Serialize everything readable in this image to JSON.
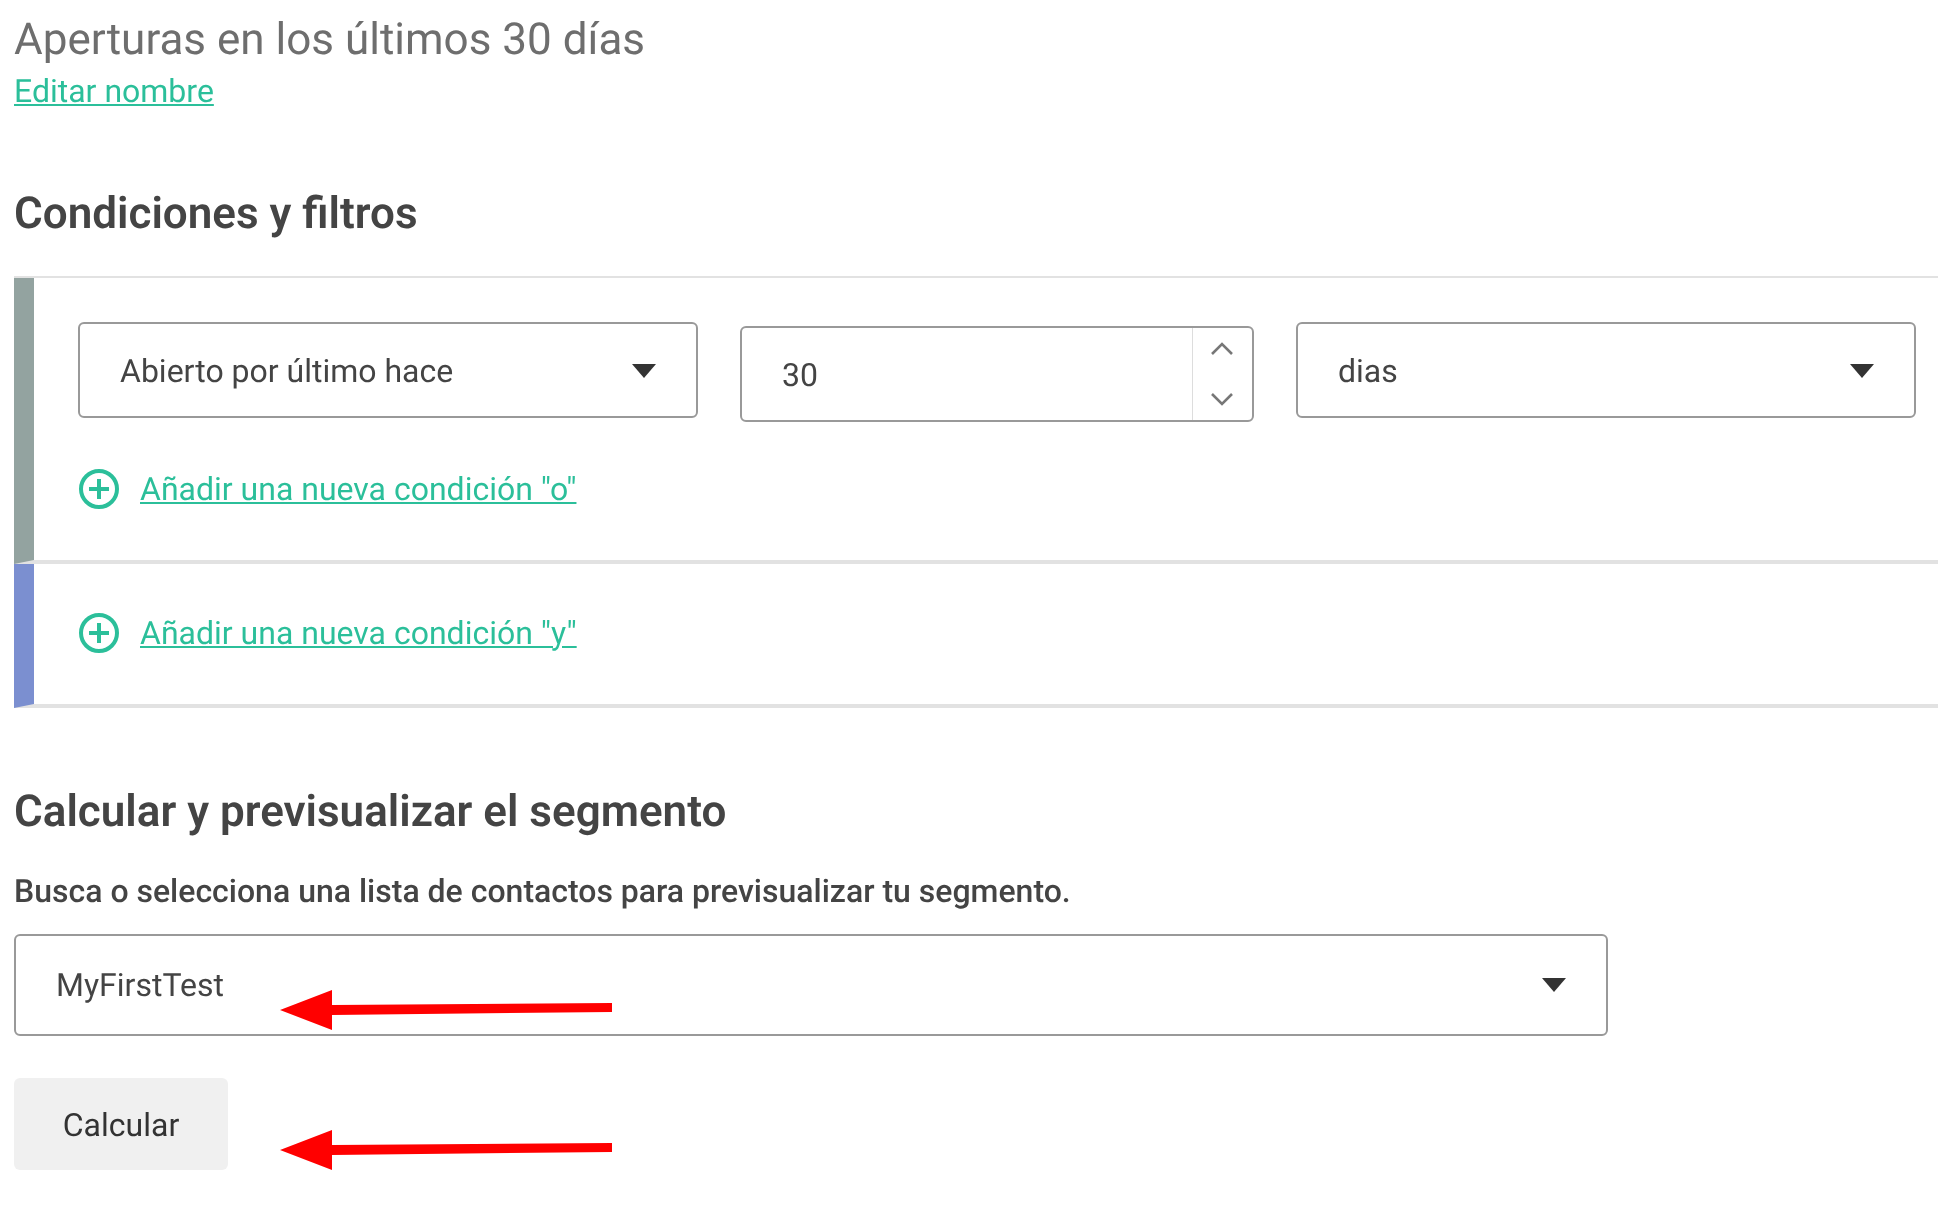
{
  "segment": {
    "title": "Aperturas en los últimos 30 días",
    "edit_link": "Editar nombre"
  },
  "conditions": {
    "heading": "Condiciones y filtros",
    "groups": [
      {
        "color": "#93a3a0",
        "fields": [
          {
            "kind": "dropdown",
            "value": "Abierto por último hace"
          },
          {
            "kind": "number",
            "value": "30"
          },
          {
            "kind": "dropdown",
            "value": "dias"
          }
        ],
        "add_link": "Añadir una nueva condición \"o\""
      },
      {
        "color": "#7b8fd0",
        "add_link": "Añadir una nueva condición \"y\""
      }
    ]
  },
  "preview": {
    "heading": "Calcular y previsualizar el segmento",
    "description": "Busca o selecciona una lista de contactos para previsualizar tu segmento.",
    "list": {
      "value": "MyFirstTest",
      "pointer_arrow": true
    },
    "button": {
      "label": "Calcular",
      "pointer_arrow": true
    }
  }
}
